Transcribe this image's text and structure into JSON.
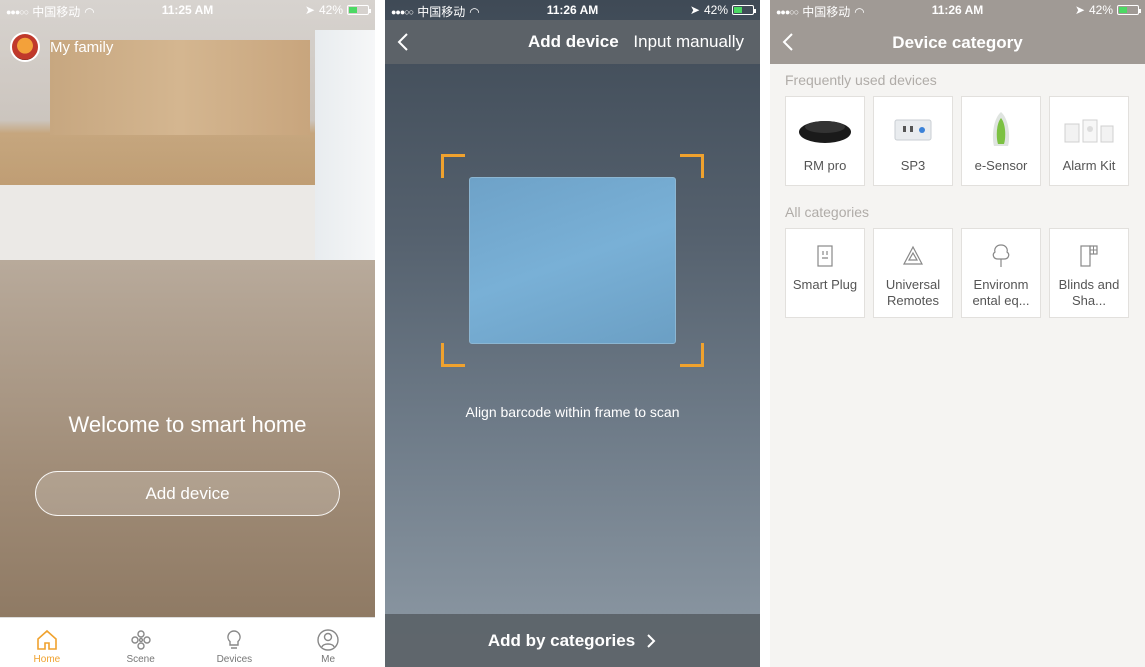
{
  "status": {
    "carrier": "中国移动",
    "battery": "42%",
    "time1": "11:25 AM",
    "time2": "11:26 AM",
    "time3": "11:26 AM"
  },
  "home": {
    "family": "My family",
    "welcome": "Welcome to smart home",
    "add_device": "Add device",
    "tabs": [
      {
        "label": "Home",
        "icon": "home-icon"
      },
      {
        "label": "Scene",
        "icon": "scene-icon"
      },
      {
        "label": "Devices",
        "icon": "bulb-icon"
      },
      {
        "label": "Me",
        "icon": "person-icon"
      }
    ],
    "accent": "#f0a22e"
  },
  "scan": {
    "title": "Add device",
    "input_manually": "Input manually",
    "align_text": "Align barcode within frame to scan",
    "by_categories": "Add by categories"
  },
  "category": {
    "title": "Device category",
    "frequent_title": "Frequently used devices",
    "frequent": [
      {
        "label": "RM pro"
      },
      {
        "label": "SP3"
      },
      {
        "label": "e-Sensor"
      },
      {
        "label": "Alarm Kit"
      }
    ],
    "all_title": "All categories",
    "all": [
      {
        "label": "Smart Plug"
      },
      {
        "label": "Universal Remotes"
      },
      {
        "label": "Environm ental eq..."
      },
      {
        "label": "Blinds and Sha..."
      }
    ]
  }
}
